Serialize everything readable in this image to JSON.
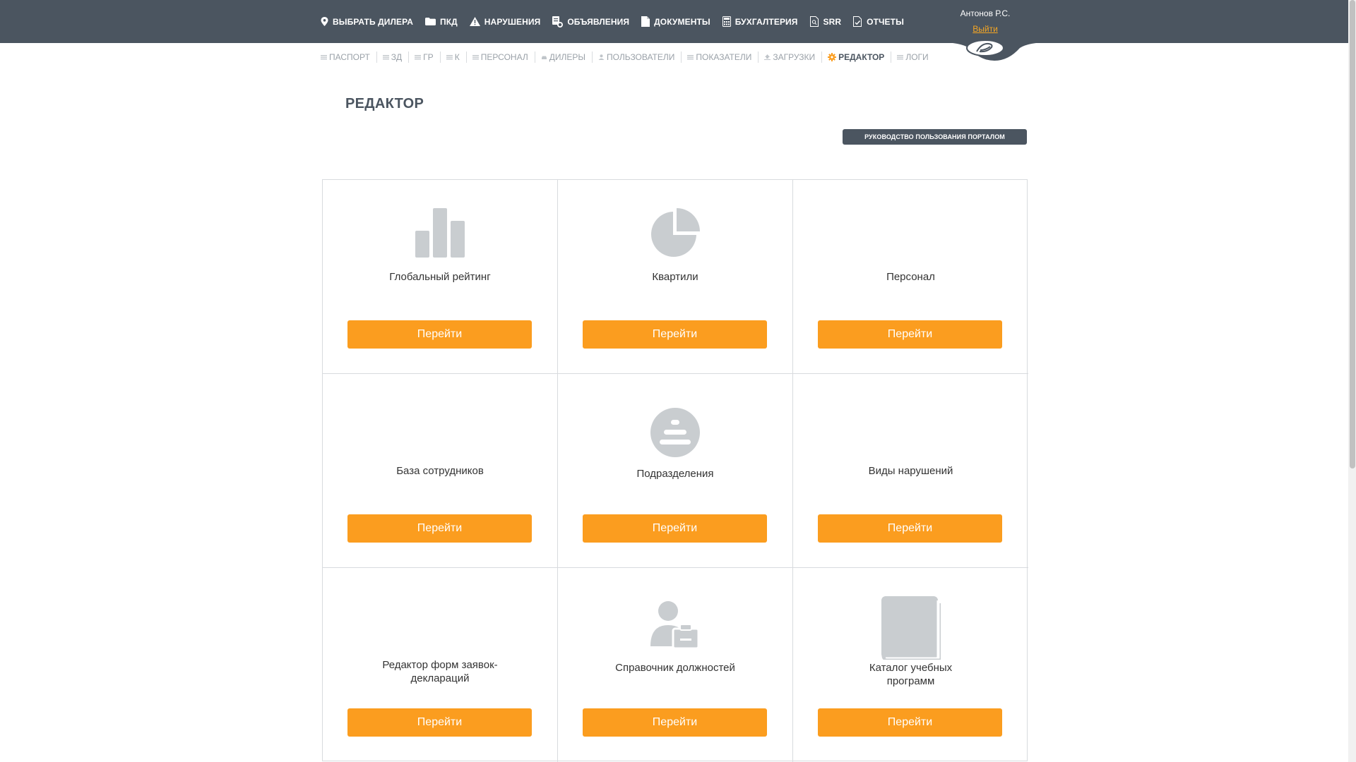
{
  "topnav": [
    {
      "label": "ВЫБРАТЬ ДИЛЕРА",
      "icon": "map-pin-icon"
    },
    {
      "label": "ПКД",
      "icon": "folder-icon"
    },
    {
      "label": "НАРУШЕНИЯ",
      "icon": "warning-icon"
    },
    {
      "label": "ОБЪЯВЛЕНИЯ",
      "icon": "announcement-icon"
    },
    {
      "label": "ДОКУМЕНТЫ",
      "icon": "document-icon"
    },
    {
      "label": "БУХГАЛТЕРИЯ",
      "icon": "calculator-icon"
    },
    {
      "label": "SRR",
      "icon": "search-document-icon"
    },
    {
      "label": "ОТЧЕТЫ",
      "icon": "report-icon"
    }
  ],
  "user": {
    "name": "Антонов Р.С.",
    "logout": "Выйти"
  },
  "subnav": [
    {
      "label": "ПАСПОРТ"
    },
    {
      "label": "ЗД"
    },
    {
      "label": "ГР"
    },
    {
      "label": "К"
    },
    {
      "label": "ПЕРСОНАЛ"
    },
    {
      "label": "ДИЛЕРЫ"
    },
    {
      "label": "ПОЛЬЗОВАТЕЛИ"
    },
    {
      "label": "ПОКАЗАТЕЛИ"
    },
    {
      "label": "ЗАГРУЗКИ"
    },
    {
      "label": "РЕДАКТОР",
      "active": true
    },
    {
      "label": "ЛОГИ"
    }
  ],
  "page": {
    "title": "РЕДАКТОР",
    "guide_button": "РУКОВОДСТВО ПОЛЬЗОВАНИЯ ПОРТАЛОМ"
  },
  "cards": [
    {
      "label": "Глобальный рейтинг",
      "icon": "bar-chart-icon",
      "button": "Перейти"
    },
    {
      "label": "Квартили",
      "icon": "pie-chart-icon",
      "button": "Перейти"
    },
    {
      "label": "Персонал",
      "icon": "",
      "button": "Перейти"
    },
    {
      "label": "База сотрудников",
      "icon": "",
      "button": "Перейти"
    },
    {
      "label": "Подразделения",
      "icon": "departments-icon",
      "button": "Перейти"
    },
    {
      "label": "Виды нарушений",
      "icon": "",
      "button": "Перейти"
    },
    {
      "label": "Редактор форм заявок-деклараций",
      "icon": "",
      "button": "Перейти"
    },
    {
      "label": "Справочник должностей",
      "icon": "person-badge-icon",
      "button": "Перейти"
    },
    {
      "label": "Каталог учебных программ",
      "icon": "book-icon",
      "button": "Перейти"
    }
  ],
  "colors": {
    "topbar": "#4b5560",
    "accent": "#fb9d1f",
    "link": "#f5a623",
    "icon_gray": "#c9cdd0"
  }
}
